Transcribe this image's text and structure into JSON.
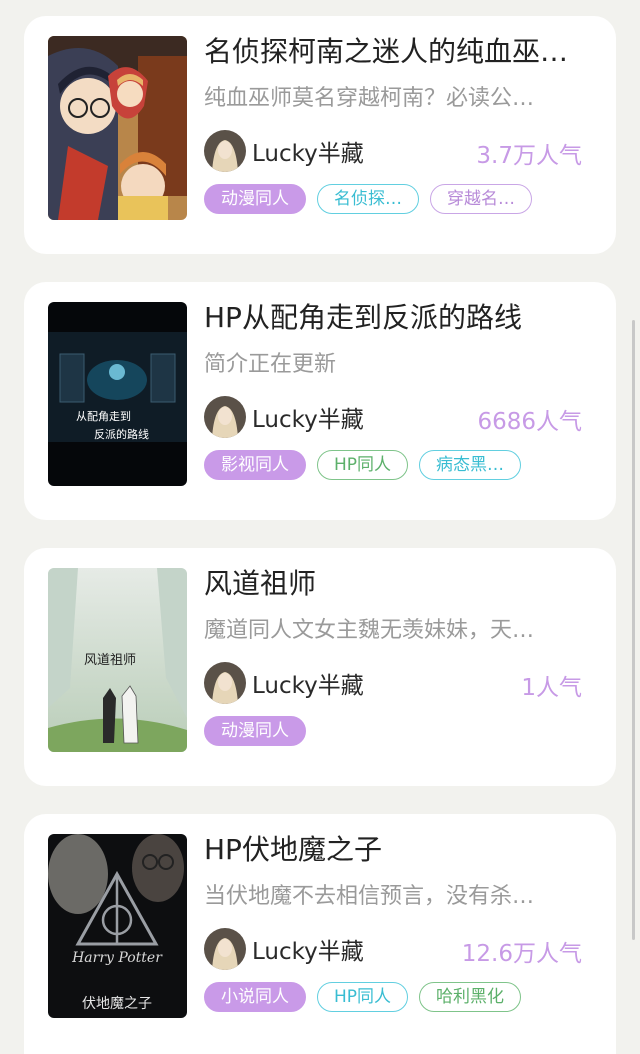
{
  "books": [
    {
      "title": "名侦探柯南之迷人的纯血巫…",
      "desc": "纯血巫师莫名穿越柯南？必读公…",
      "author": "Lucky半藏",
      "popularity": "3.7万人气",
      "tags": [
        "动漫同人",
        "名侦探…",
        "穿越名…"
      ]
    },
    {
      "title": "HP从配角走到反派的路线",
      "desc": "简介正在更新",
      "author": "Lucky半藏",
      "popularity": "6686人气",
      "tags": [
        "影视同人",
        "HP同人",
        "病态黑…"
      ],
      "cover_text": [
        "从配角走到",
        "反派的路线"
      ]
    },
    {
      "title": "风道祖师",
      "desc": "魔道同人文女主魏无羡妹妹，天…",
      "author": "Lucky半藏",
      "popularity": "1人气",
      "tags": [
        "动漫同人"
      ],
      "cover_text": [
        "风道祖师"
      ]
    },
    {
      "title": "HP伏地魔之子",
      "desc": "当伏地魔不去相信预言，没有杀…",
      "author": "Lucky半藏",
      "popularity": "12.6万人气",
      "tags": [
        "小说同人",
        "HP同人",
        "哈利黑化"
      ],
      "cover_text": [
        "Harry Potter",
        "伏地魔之子"
      ]
    }
  ],
  "colors": {
    "accent_purple": "#c99ae8",
    "tag_cyan": "#39bdd2",
    "tag_green": "#5cb06a",
    "popularity": "#c79ae6"
  }
}
